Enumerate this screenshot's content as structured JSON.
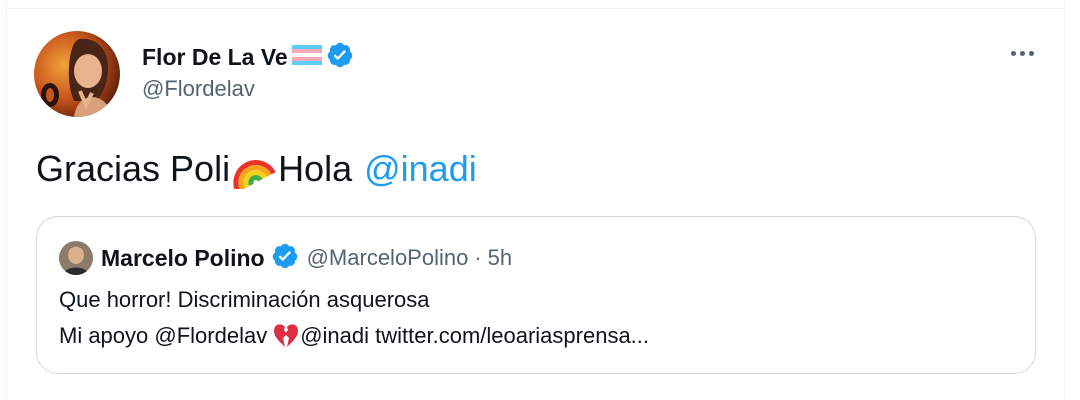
{
  "author": {
    "display_name": "Flor De La Ve",
    "handle": "@Flordelav",
    "flag_icon": "transgender-flag-icon",
    "verified_icon": "verified-badge-icon"
  },
  "tweet": {
    "text_part1": "Gracias Poli",
    "emoji1": "rainbow-icon",
    "text_part2": "Hola",
    "mention": "@inadi"
  },
  "more_icon": "more-options-icon",
  "quoted": {
    "display_name": "Marcelo Polino",
    "handle": "@MarceloPolino",
    "separator": "·",
    "time": "5h",
    "line1": "Que horror! Discriminación asquerosa",
    "line2_part1": "Mi apoyo @Flordelav",
    "line2_emoji": "broken-heart-icon",
    "line2_part2": "@inadi twitter.com/leoariasprensa..."
  },
  "colors": {
    "link": "#1d9bf0",
    "verified": "#1d9bf0",
    "secondary_text": "#536471",
    "border": "#cfd9de"
  }
}
